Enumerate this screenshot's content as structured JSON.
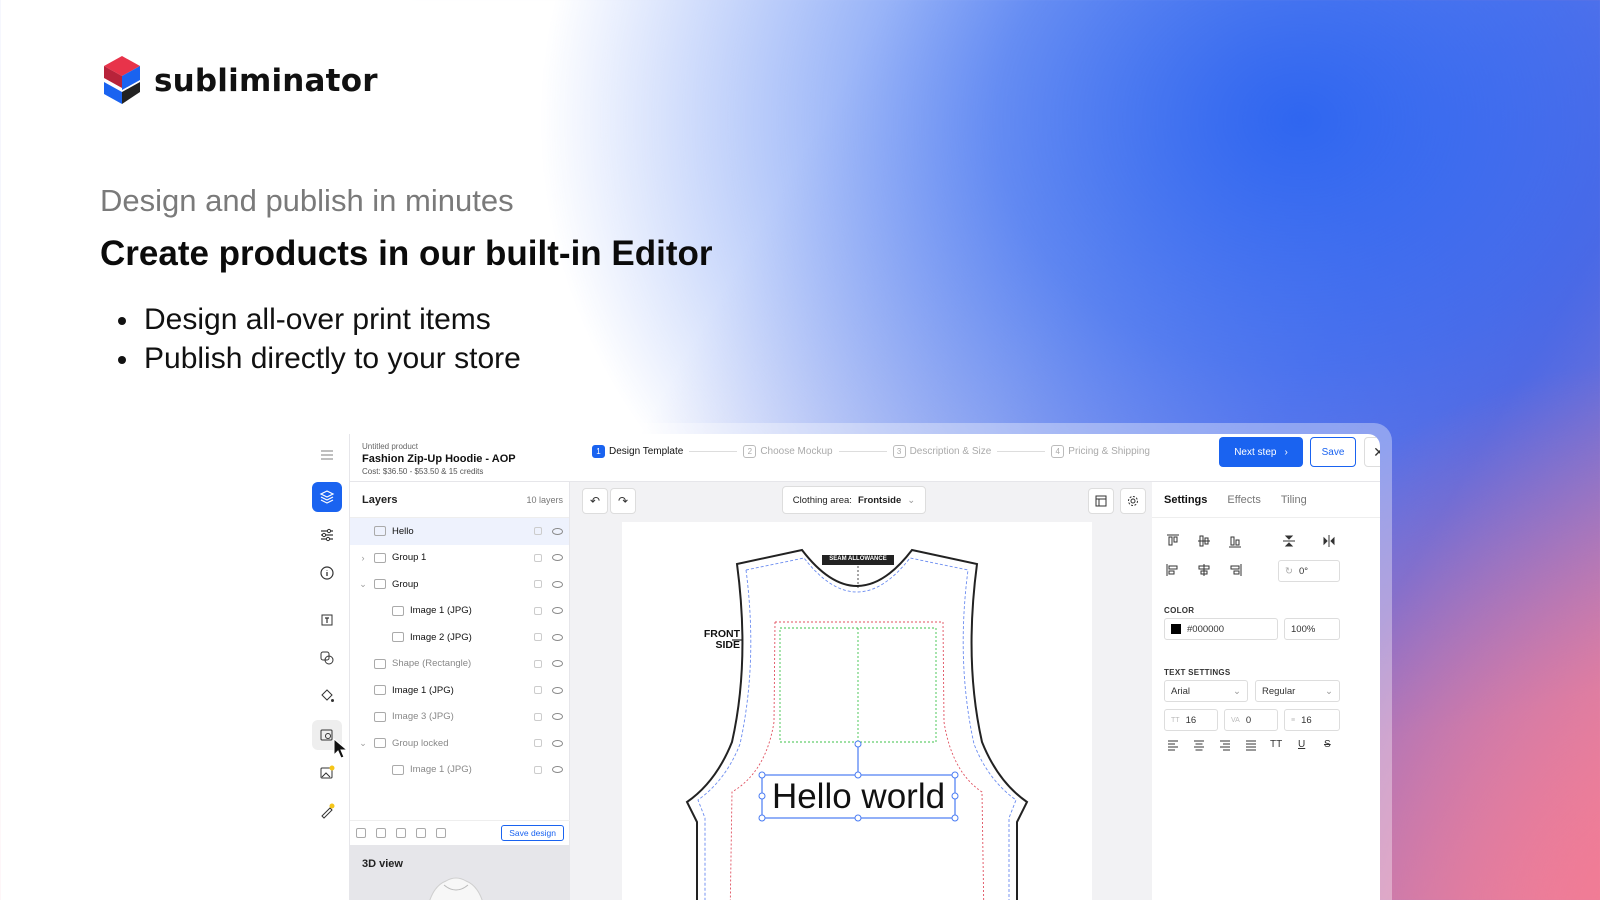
{
  "brand": {
    "name": "subliminator",
    "colors": {
      "red": "#e8334a",
      "blue": "#1a63f0",
      "dark": "#222222"
    }
  },
  "hero": {
    "subhead": "Design and publish in minutes",
    "headline": "Create products in our built-in Editor",
    "bullets": [
      "Design all-over print items",
      "Publish directly to your store"
    ]
  },
  "editor": {
    "product": {
      "status": "Untitled product",
      "title": "Fashion Zip-Up Hoodie - AOP",
      "cost": "Cost: $36.50 - $53.50 & 15 credits"
    },
    "steps": [
      {
        "num": "1",
        "label": "Design Template",
        "active": true
      },
      {
        "num": "2",
        "label": "Choose Mockup",
        "active": false
      },
      {
        "num": "3",
        "label": "Description & Size",
        "active": false
      },
      {
        "num": "4",
        "label": "Pricing & Shipping",
        "active": false
      }
    ],
    "buttons": {
      "next": "Next step",
      "save": "Save",
      "close": "✕"
    },
    "rail_icons": [
      "menu-icon",
      "layers-icon",
      "sliders-icon",
      "info-icon",
      "text-icon",
      "shapes-icon",
      "fill-icon",
      "image-search-icon",
      "ai-image-icon",
      "ai-edit-icon"
    ],
    "layers": {
      "title": "Layers",
      "count": "10 layers",
      "items": [
        {
          "label": "Hello",
          "indent": 0,
          "chev": "",
          "selected": true,
          "dim": false
        },
        {
          "label": "Group 1",
          "indent": 0,
          "chev": "›",
          "selected": false,
          "dim": false
        },
        {
          "label": "Group",
          "indent": 0,
          "chev": "⌄",
          "selected": false,
          "dim": false
        },
        {
          "label": "Image 1 (JPG)",
          "indent": 1,
          "chev": "",
          "selected": false,
          "dim": false
        },
        {
          "label": "Image 2 (JPG)",
          "indent": 1,
          "chev": "",
          "selected": false,
          "dim": false
        },
        {
          "label": "Shape (Rectangle)",
          "indent": 0,
          "chev": "",
          "selected": false,
          "dim": true
        },
        {
          "label": "Image 1 (JPG)",
          "indent": 0,
          "chev": "",
          "selected": false,
          "dim": false
        },
        {
          "label": "Image 3 (JPG)",
          "indent": 0,
          "chev": "",
          "selected": false,
          "dim": true
        },
        {
          "label": "Group locked",
          "indent": 0,
          "chev": "⌄",
          "selected": false,
          "dim": true
        },
        {
          "label": "Image 1 (JPG)",
          "indent": 1,
          "chev": "",
          "selected": false,
          "dim": true
        }
      ],
      "save_design": "Save design",
      "view3d": "3D view"
    },
    "canvas": {
      "area_label": "Clothing area:",
      "area_value": "Frontside",
      "undo": "↶",
      "redo": "↷",
      "seam_label": "SEAM ALLOWANCE",
      "front_side": "FRONT SIDE",
      "text_content": "Hello world"
    },
    "settings": {
      "tabs": [
        "Settings",
        "Effects",
        "Tiling"
      ],
      "rotation": "0°",
      "color_title": "COLOR",
      "color_hex": "#000000",
      "opacity": "100%",
      "text_title": "TEXT SETTINGS",
      "font": "Arial",
      "weight": "Regular",
      "size": "16",
      "letter_spacing": "0",
      "line_height": "16",
      "format_tt": "TT",
      "format_u": "U",
      "format_s": "S"
    }
  }
}
